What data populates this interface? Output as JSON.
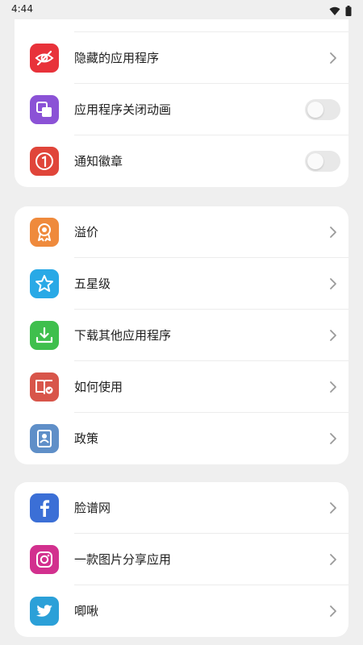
{
  "status": {
    "time": "4:44"
  },
  "groups": [
    {
      "items": [
        {
          "label": "隐藏的应用程序",
          "icon": "eye-slash-icon",
          "color": "#e8323a",
          "control": "chevron"
        },
        {
          "label": "应用程序关闭动画",
          "icon": "stacked-windows-icon",
          "color": "#8b52d6",
          "control": "toggle",
          "toggle_on": false
        },
        {
          "label": "通知徽章",
          "icon": "badge-number-one-icon",
          "color": "#e0453a",
          "control": "toggle",
          "toggle_on": false
        }
      ]
    },
    {
      "items": [
        {
          "label": "溢价",
          "icon": "award-ribbon-icon",
          "color": "#ef8a3c",
          "control": "chevron"
        },
        {
          "label": "五星级",
          "icon": "star-icon",
          "color": "#29a9e6",
          "control": "chevron"
        },
        {
          "label": "下载其他应用程序",
          "icon": "download-icon",
          "color": "#3fbf4d",
          "control": "chevron"
        },
        {
          "label": "如何使用",
          "icon": "guide-book-icon",
          "color": "#d8554a",
          "control": "chevron"
        },
        {
          "label": "政策",
          "icon": "policy-document-icon",
          "color": "#5f8fc8",
          "control": "chevron"
        }
      ]
    },
    {
      "items": [
        {
          "label": "脸谱网",
          "icon": "facebook-icon",
          "color": "#3b6fd6",
          "control": "chevron"
        },
        {
          "label": "一款图片分享应用",
          "icon": "instagram-icon",
          "color": "#d2308e",
          "control": "chevron"
        },
        {
          "label": "唧啾",
          "icon": "twitter-bird-icon",
          "color": "#2ba0d8",
          "control": "chevron"
        }
      ]
    }
  ],
  "colors": {
    "background": "#efefef",
    "card": "#ffffff",
    "divider": "#ececec",
    "chevron": "#9a9a9a",
    "toggle_off": "#e8e8e8"
  }
}
